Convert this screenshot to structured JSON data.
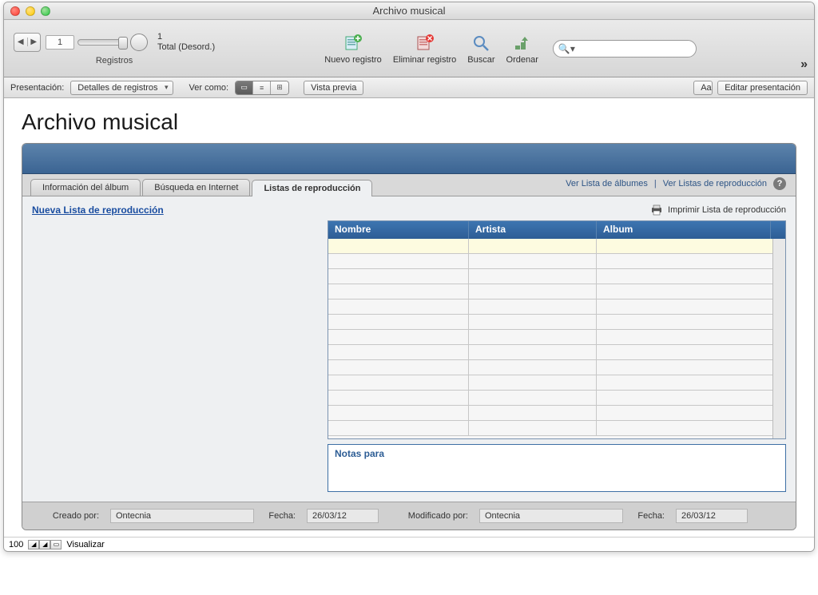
{
  "window": {
    "title": "Archivo musical"
  },
  "toolbar": {
    "record_number": "1",
    "record_stats_line1": "1",
    "record_stats_line2": "Total (Desord.)",
    "records_label": "Registros",
    "new_record": "Nuevo registro",
    "delete_record": "Eliminar registro",
    "find": "Buscar",
    "sort": "Ordenar",
    "search_placeholder": ""
  },
  "layoutbar": {
    "presentation_label": "Presentación:",
    "presentation_value": "Detalles de registros",
    "view_as_label": "Ver como:",
    "preview": "Vista previa",
    "aa": "Aa",
    "edit_layout": "Editar presentación"
  },
  "page": {
    "title": "Archivo musical"
  },
  "tabs": {
    "album_info": "Información del álbum",
    "internet_search": "Búsqueda en Internet",
    "playlists": "Listas de reproducción"
  },
  "panel_links": {
    "view_albums": "Ver Lista de álbumes",
    "view_playlists": "Ver Listas de reproducción"
  },
  "body": {
    "new_playlist": "Nueva Lista de reproducción",
    "print_playlist": "Imprimir Lista de reproducción"
  },
  "table": {
    "col_nombre": "Nombre",
    "col_artista": "Artista",
    "col_album": "Album"
  },
  "notes": {
    "header": "Notas para"
  },
  "footer": {
    "created_by_label": "Creado por:",
    "created_by_value": "Ontecnia",
    "created_date_label": "Fecha:",
    "created_date_value": "26/03/12",
    "modified_by_label": "Modificado por:",
    "modified_by_value": "Ontecnia",
    "modified_date_label": "Fecha:",
    "modified_date_value": "26/03/12"
  },
  "statusbar": {
    "zoom": "100",
    "mode": "Visualizar"
  }
}
